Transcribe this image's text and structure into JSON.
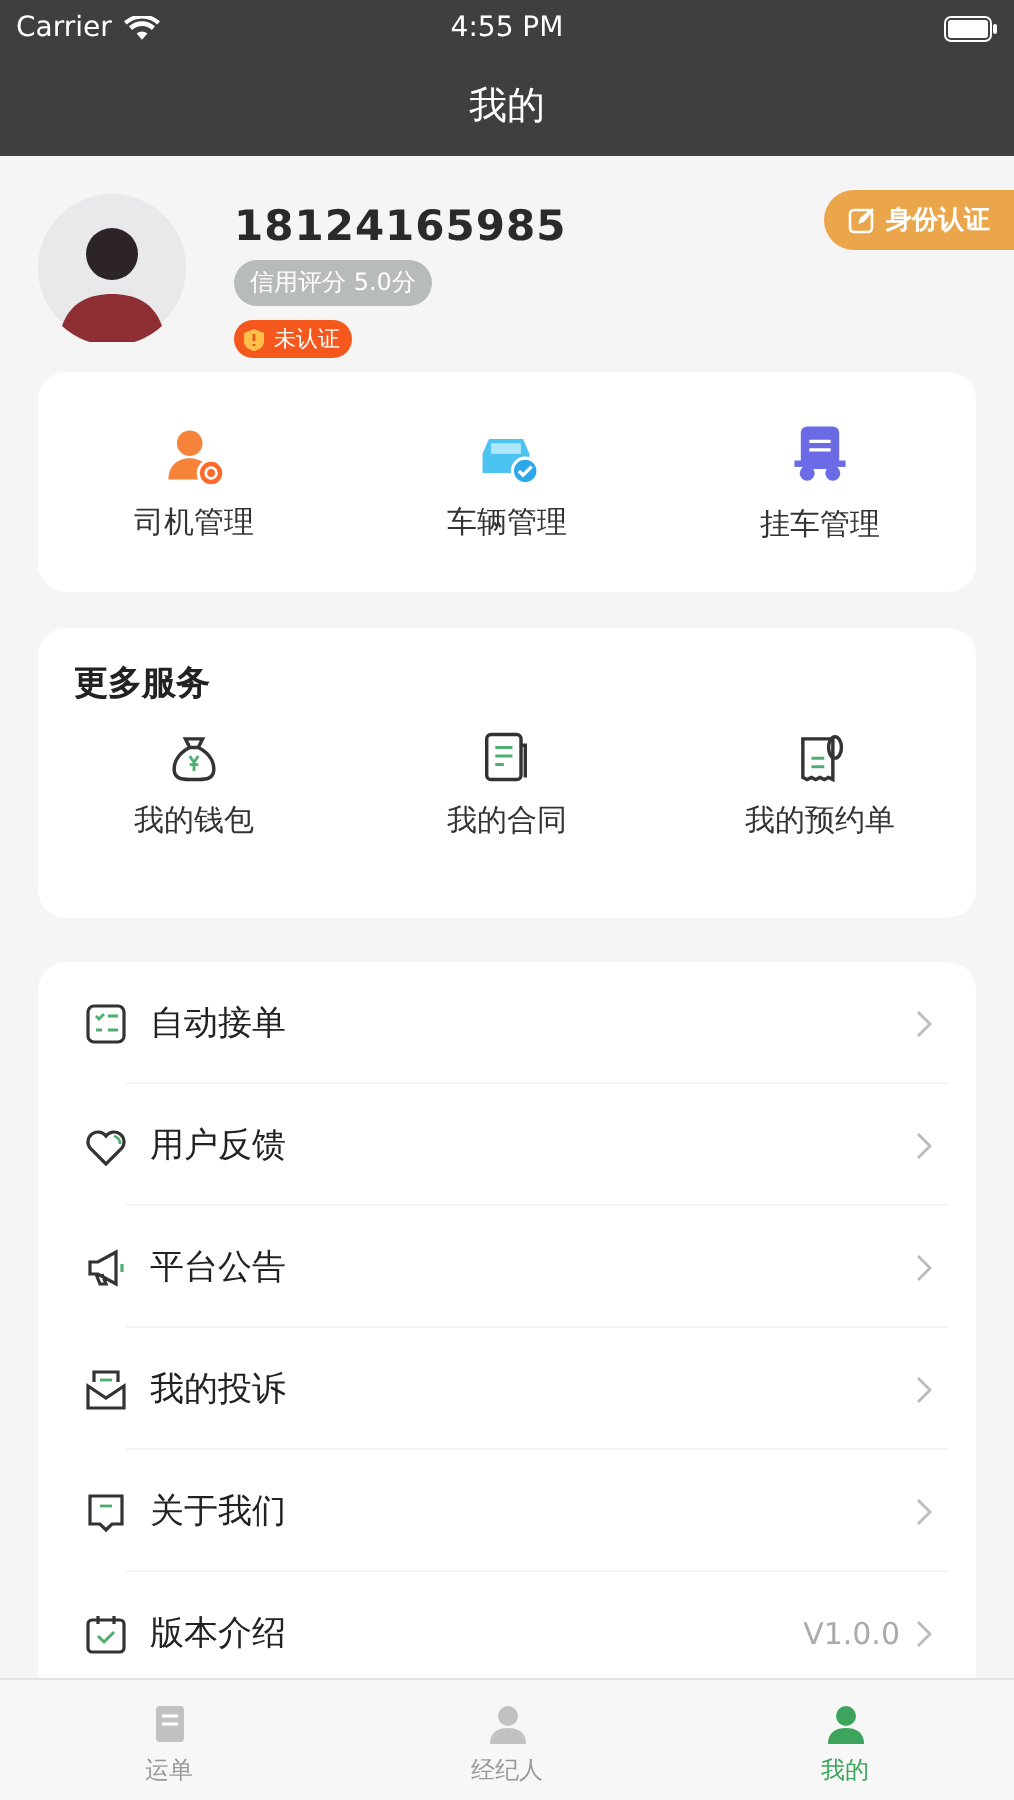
{
  "status_bar": {
    "carrier": "Carrier",
    "time": "4:55 PM"
  },
  "nav_bar": {
    "title": "我的"
  },
  "profile": {
    "phone": "18124165985",
    "credit": "信用评分 5.0分",
    "verify_status": "未认证",
    "verify_button": "身份认证"
  },
  "management": [
    {
      "label": "司机管理"
    },
    {
      "label": "车辆管理"
    },
    {
      "label": "挂车管理"
    }
  ],
  "more_services": {
    "title": "更多服务",
    "items": [
      {
        "label": "我的钱包"
      },
      {
        "label": "我的合同"
      },
      {
        "label": "我的预约单"
      }
    ]
  },
  "menu": [
    {
      "label": "自动接单"
    },
    {
      "label": "用户反馈"
    },
    {
      "label": "平台公告"
    },
    {
      "label": "我的投诉"
    },
    {
      "label": "关于我们"
    },
    {
      "label": "版本介绍",
      "value": "V1.0.0"
    }
  ],
  "tab_bar": [
    {
      "label": "运单",
      "selected": false
    },
    {
      "label": "经纪人",
      "selected": false
    },
    {
      "label": "我的",
      "selected": true
    }
  ]
}
